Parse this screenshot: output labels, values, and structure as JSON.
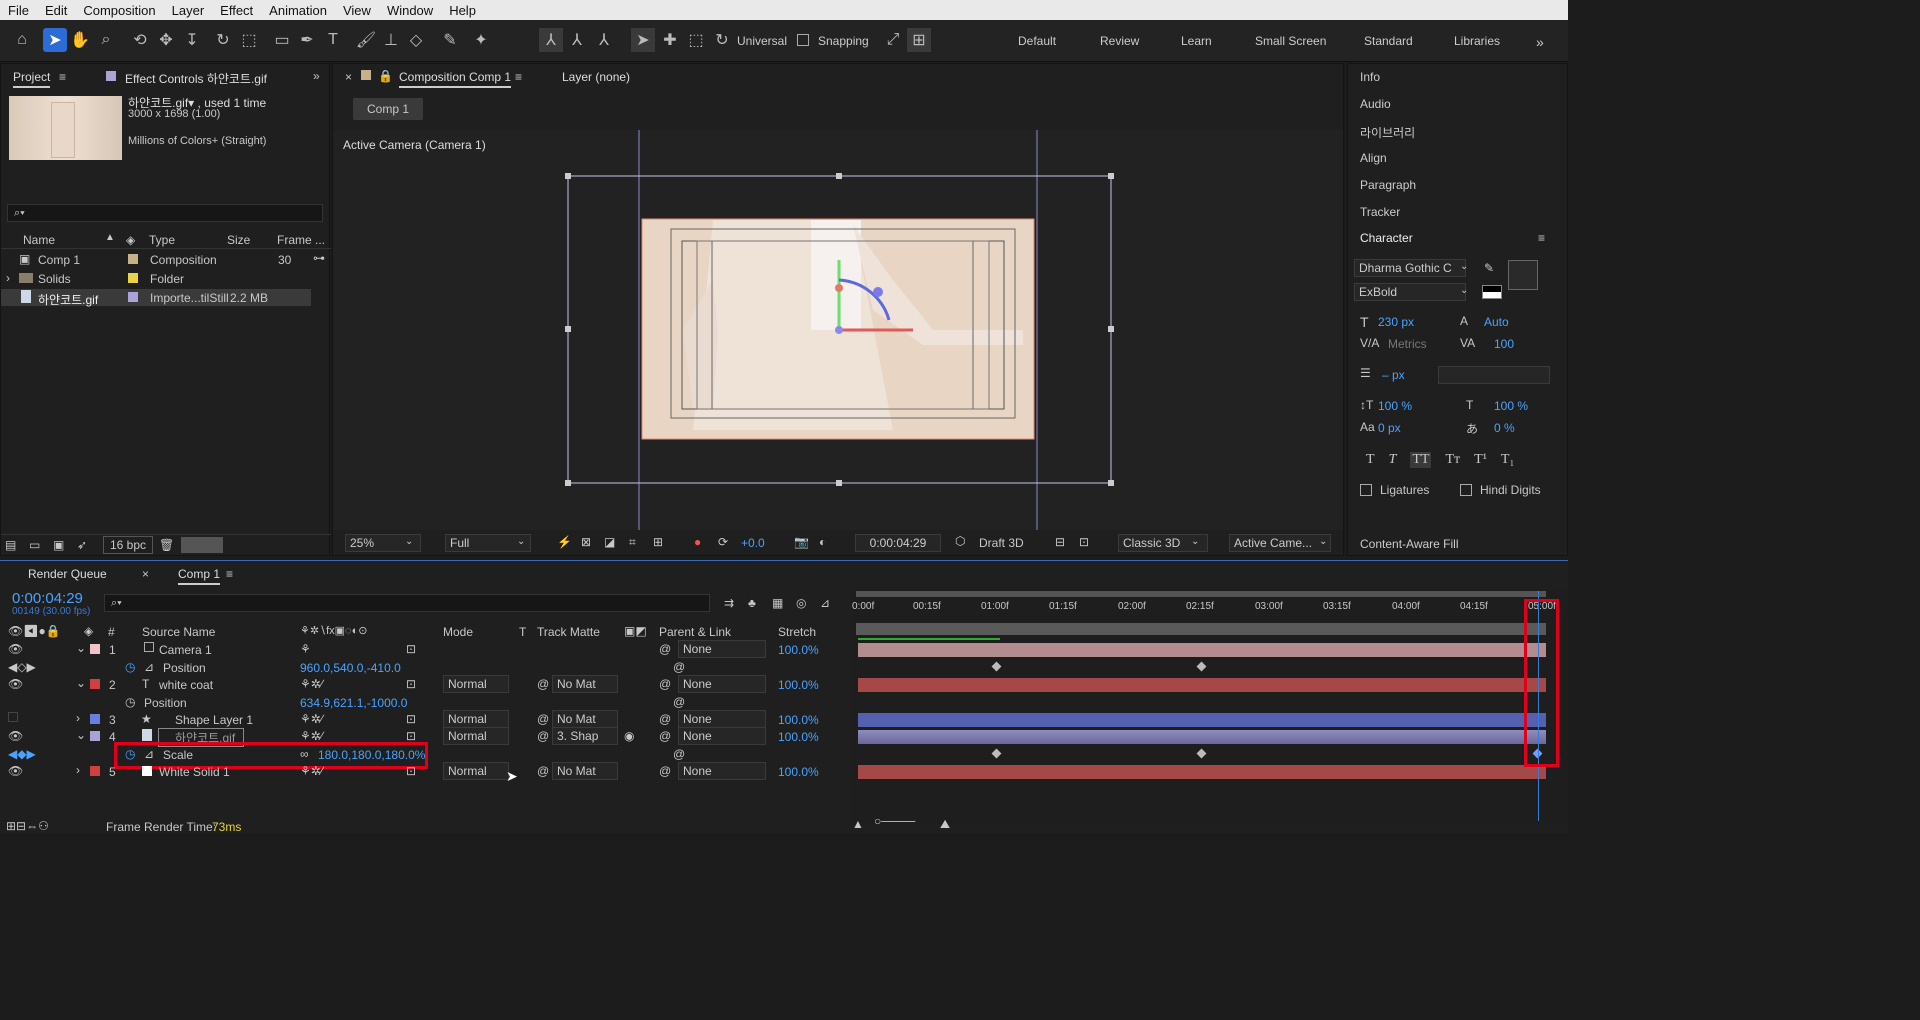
{
  "menu": [
    "File",
    "Edit",
    "Composition",
    "Layer",
    "Effect",
    "Animation",
    "View",
    "Window",
    "Help"
  ],
  "toolbar": {
    "universal": "Universal",
    "snapping": "Snapping"
  },
  "workspaces": [
    "Default",
    "Review",
    "Learn",
    "Small Screen",
    "Standard",
    "Libraries"
  ],
  "project": {
    "tab": "Project",
    "effect_tab": "Effect Controls 하얀코트.gif",
    "file_name": "하얀코트.gif▾ , used 1 time",
    "dims": "3000 x 1698 (1.00)",
    "colors": "Millions of Colors+ (Straight)",
    "columns": [
      "Name",
      "Type",
      "Size",
      "Frame ..."
    ],
    "items": [
      {
        "name": "Comp 1",
        "type": "Composition",
        "size": "",
        "frame": "30"
      },
      {
        "name": "Solids",
        "type": "Folder",
        "size": "",
        "frame": ""
      },
      {
        "name": "하얀코트.gif",
        "type": "Importe...tilStill",
        "size": "2.2 MB",
        "frame": ""
      }
    ],
    "bpc": "16 bpc"
  },
  "comp": {
    "tab": "Composition Comp 1",
    "layer_tab": "Layer (none)",
    "crumb": "Comp 1",
    "camera_label": "Active Camera (Camera 1)",
    "zoom": "25%",
    "quality": "Full",
    "exposure": "+0.0",
    "time": "0:00:04:29",
    "draft": "Draft 3D",
    "renderer": "Classic 3D",
    "view": "Active Came..."
  },
  "right": {
    "items": [
      "Info",
      "Audio",
      "라이브러리",
      "Align",
      "Paragraph",
      "Tracker"
    ],
    "character": "Character",
    "font": "Dharma Gothic C",
    "style": "ExBold",
    "size": "230 px",
    "leading": "Auto",
    "kerning": "Metrics",
    "tracking": "100",
    "stroke": "– px",
    "vscale": "100 %",
    "hscale": "100 %",
    "baseline": "0 px",
    "tsume": "0 %",
    "ligatures": "Ligatures",
    "hindi": "Hindi Digits",
    "caf": "Content-Aware Fill"
  },
  "timeline": {
    "render_tab": "Render Queue",
    "comp_tab": "Comp 1",
    "time": "0:00:04:29",
    "frames": "00149 (30.00 fps)",
    "headers": {
      "source": "Source Name",
      "mode": "Mode",
      "t": "T",
      "matte": "Track Matte",
      "parent": "Parent & Link",
      "stretch": "Stretch"
    },
    "ruler": [
      "0:00f",
      "00:15f",
      "01:00f",
      "01:15f",
      "02:00f",
      "02:15f",
      "03:00f",
      "03:15f",
      "04:00f",
      "04:15f",
      "05:00f"
    ],
    "layers": [
      {
        "num": "1",
        "name": "Camera 1",
        "mode": "",
        "matte": "",
        "parent": "None",
        "stretch": "100.0%"
      },
      {
        "prop": "Position",
        "value": "960.0,540.0,-410.0"
      },
      {
        "num": "2",
        "name": "white coat",
        "mode": "Normal",
        "matte": "No Mat",
        "parent": "None",
        "stretch": "100.0%"
      },
      {
        "prop": "Position",
        "value": "634.9,621.1,-1000.0"
      },
      {
        "num": "3",
        "name": "Shape Layer 1",
        "mode": "Normal",
        "matte": "No Mat",
        "parent": "None",
        "stretch": "100.0%"
      },
      {
        "num": "4",
        "name": "하얀코트.gif",
        "mode": "Normal",
        "matte": "3. Shap",
        "parent": "None",
        "stretch": "100.0%"
      },
      {
        "prop": "Scale",
        "value": "180.0,180.0,180.0%"
      },
      {
        "num": "5",
        "name": "White Solid 1",
        "mode": "Normal",
        "matte": "No Mat",
        "parent": "None",
        "stretch": "100.0%"
      }
    ],
    "render_time_label": "Frame Render Time:",
    "render_time": "73ms"
  },
  "colors": {
    "accent": "#2d6bd6",
    "highlight": "#e0001b"
  }
}
